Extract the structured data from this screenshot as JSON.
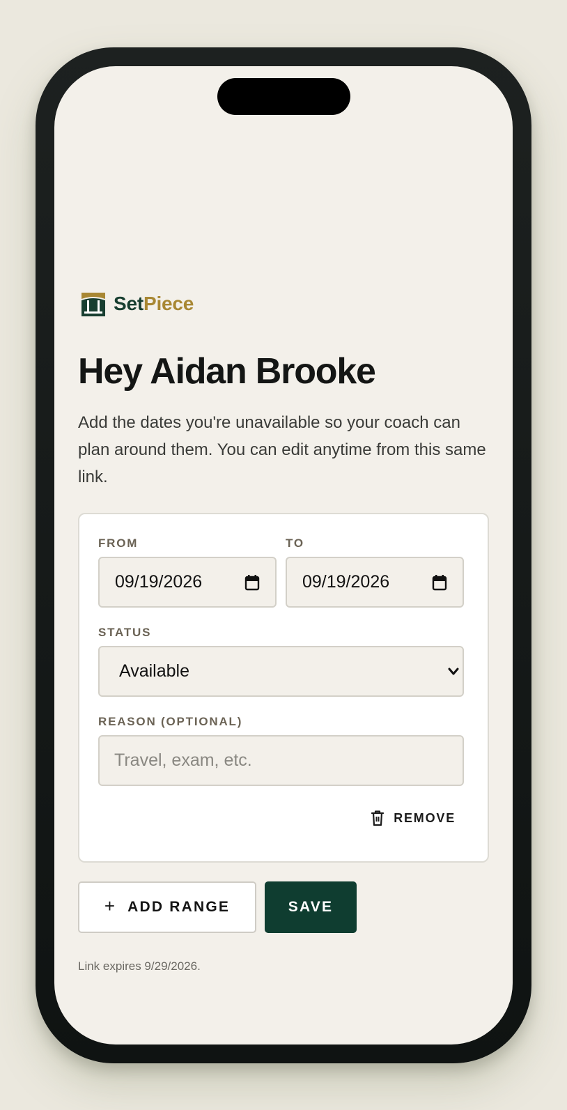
{
  "brand": {
    "name_part1": "Set",
    "name_part2": "Piece",
    "logo_icon": "setpiece-logo-icon",
    "color_primary": "#173e30",
    "color_accent": "#a88733"
  },
  "header": {
    "title": "Hey Aidan Brooke",
    "intro": "Add the dates you're unavailable so your coach can plan around them. You can edit anytime from this same link."
  },
  "range": {
    "from_label": "FROM",
    "from_value": "09/19/2026",
    "to_label": "TO",
    "to_value": "09/19/2026",
    "status_label": "STATUS",
    "status_value": "Available",
    "reason_label": "REASON (OPTIONAL)",
    "reason_placeholder": "Travel, exam, etc.",
    "reason_value": "",
    "remove_label": "REMOVE"
  },
  "actions": {
    "add_range_icon": "+",
    "add_range_label": "ADD RANGE",
    "save_label": "SAVE",
    "save_color": "#0f3d30"
  },
  "footer": {
    "expires": "Link expires 9/29/2026."
  }
}
